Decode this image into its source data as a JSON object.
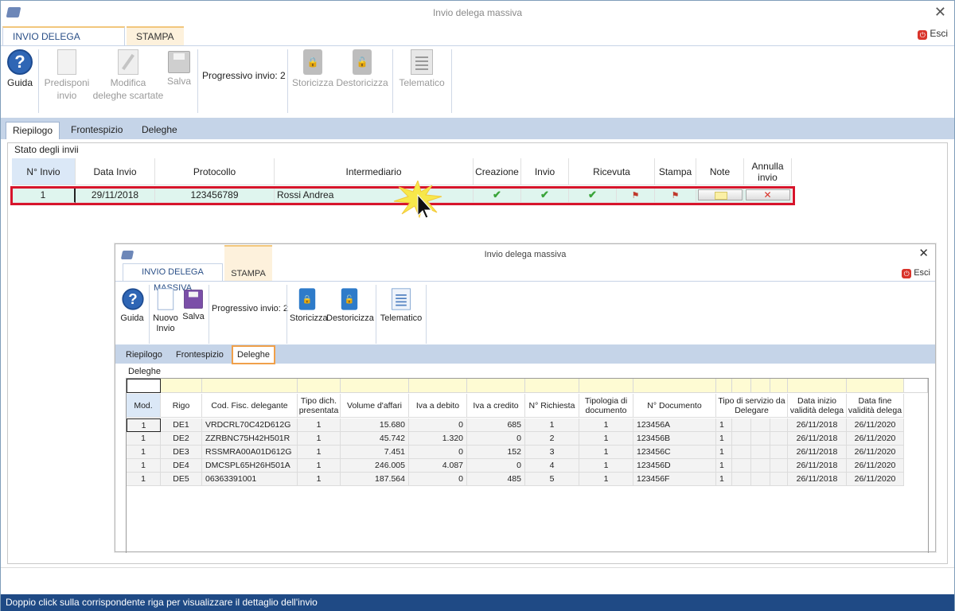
{
  "window": {
    "title": "Invio delega massiva",
    "close_glyph": "✕"
  },
  "ribbon_tabs": {
    "main": "INVIO DELEGA MASSIVA",
    "stampa": "STAMPA"
  },
  "esci": {
    "label": "Esci",
    "icon_glyph": "⏻"
  },
  "toolbar": {
    "guida": "Guida",
    "predisponi_1": "Predisponi",
    "predisponi_2": "invio",
    "modifica_1": "Modifica",
    "modifica_2": "deleghe scartate",
    "salva": "Salva",
    "progressivo": "Progressivo invio: 2",
    "storicizza": "Storicizza",
    "destoricizza": "Destoricizza",
    "telematico": "Telematico"
  },
  "subtabs": [
    "Riepilogo",
    "Frontespizio",
    "Deleghe"
  ],
  "panel_title": "Stato degli invii",
  "grid": {
    "headers": {
      "n_invio": "N° Invio",
      "data_invio": "Data Invio",
      "protocollo": "Protocollo",
      "intermediario": "Intermediario",
      "creazione": "Creazione",
      "invio": "Invio",
      "ricevuta": "Ricevuta",
      "stampa": "Stampa",
      "note": "Note",
      "annulla_1": "Annulla",
      "annulla_2": "invio"
    },
    "row": {
      "n_invio": "1",
      "data_invio": "29/11/2018",
      "protocollo": "123456789",
      "intermediario": "Rossi Andrea",
      "check_glyph": "✔",
      "pdf_glyph": "⚑",
      "annulla_glyph": "✕"
    }
  },
  "status_bar": "Doppio click sulla corrispondente riga per visualizzare il dettaglio dell'invio",
  "inner": {
    "title": "Invio delega massiva",
    "tab_main": "INVIO DELEGA MASSIVA",
    "tab_stampa": "STAMPA",
    "esci": "Esci",
    "guida": "Guida",
    "nuovo_1": "Nuovo",
    "nuovo_2": "Invio",
    "salva": "Salva",
    "progressivo": "Progressivo invio: 2",
    "storicizza": "Storicizza",
    "destoricizza": "Destoricizza",
    "telematico": "Telematico",
    "subtabs": [
      "Riepilogo",
      "Frontespizio",
      "Deleghe"
    ],
    "group_title": "Deleghe",
    "headers": {
      "mod": "Mod.",
      "rigo": "Rigo",
      "cf": "Cod. Fisc. delegante",
      "tipo_1": "Tipo dich.",
      "tipo_2": "presentata",
      "volume": "Volume d'affari",
      "iva_debito": "Iva a debito",
      "iva_credito": "Iva a credito",
      "richiesta": "N° Richiesta",
      "tipologia_1": "Tipologia di",
      "tipologia_2": "documento",
      "ndoc": "N° Documento",
      "servizio_1": "Tipo di servizio da",
      "servizio_2": "Delegare",
      "inizio_1": "Data inizio",
      "inizio_2": "validità delega",
      "fine_1": "Data fine",
      "fine_2": "validità delega"
    },
    "rows": [
      {
        "mod": "1",
        "rigo": "DE1",
        "cf": "VRDCRL70C42D612G",
        "tipo": "1",
        "volume": "15.680",
        "iva_debito": "0",
        "iva_credito": "685",
        "richiesta": "1",
        "tipologia": "1",
        "ndoc": "123456A",
        "servizio": "1",
        "inizio": "26/11/2018",
        "fine": "26/11/2020"
      },
      {
        "mod": "1",
        "rigo": "DE2",
        "cf": "ZZRBNC75H42H501R",
        "tipo": "1",
        "volume": "45.742",
        "iva_debito": "1.320",
        "iva_credito": "0",
        "richiesta": "2",
        "tipologia": "1",
        "ndoc": "123456B",
        "servizio": "1",
        "inizio": "26/11/2018",
        "fine": "26/11/2020"
      },
      {
        "mod": "1",
        "rigo": "DE3",
        "cf": "RSSMRA00A01D612G",
        "tipo": "1",
        "volume": "7.451",
        "iva_debito": "0",
        "iva_credito": "152",
        "richiesta": "3",
        "tipologia": "1",
        "ndoc": "123456C",
        "servizio": "1",
        "inizio": "26/11/2018",
        "fine": "26/11/2020"
      },
      {
        "mod": "1",
        "rigo": "DE4",
        "cf": "DMCSPL65H26H501A",
        "tipo": "1",
        "volume": "246.005",
        "iva_debito": "4.087",
        "iva_credito": "0",
        "richiesta": "4",
        "tipologia": "1",
        "ndoc": "123456D",
        "servizio": "1",
        "inizio": "26/11/2018",
        "fine": "26/11/2020"
      },
      {
        "mod": "1",
        "rigo": "DE5",
        "cf": "06363391001",
        "tipo": "1",
        "volume": "187.564",
        "iva_debito": "0",
        "iva_credito": "485",
        "richiesta": "5",
        "tipologia": "1",
        "ndoc": "123456F",
        "servizio": "1",
        "inizio": "26/11/2018",
        "fine": "26/11/2020"
      }
    ]
  },
  "colors": {
    "highlight": "#d7142b",
    "tab_orange": "#f0a04a",
    "status_bg": "#1f4a85",
    "row_bg": "#dff5ee"
  }
}
